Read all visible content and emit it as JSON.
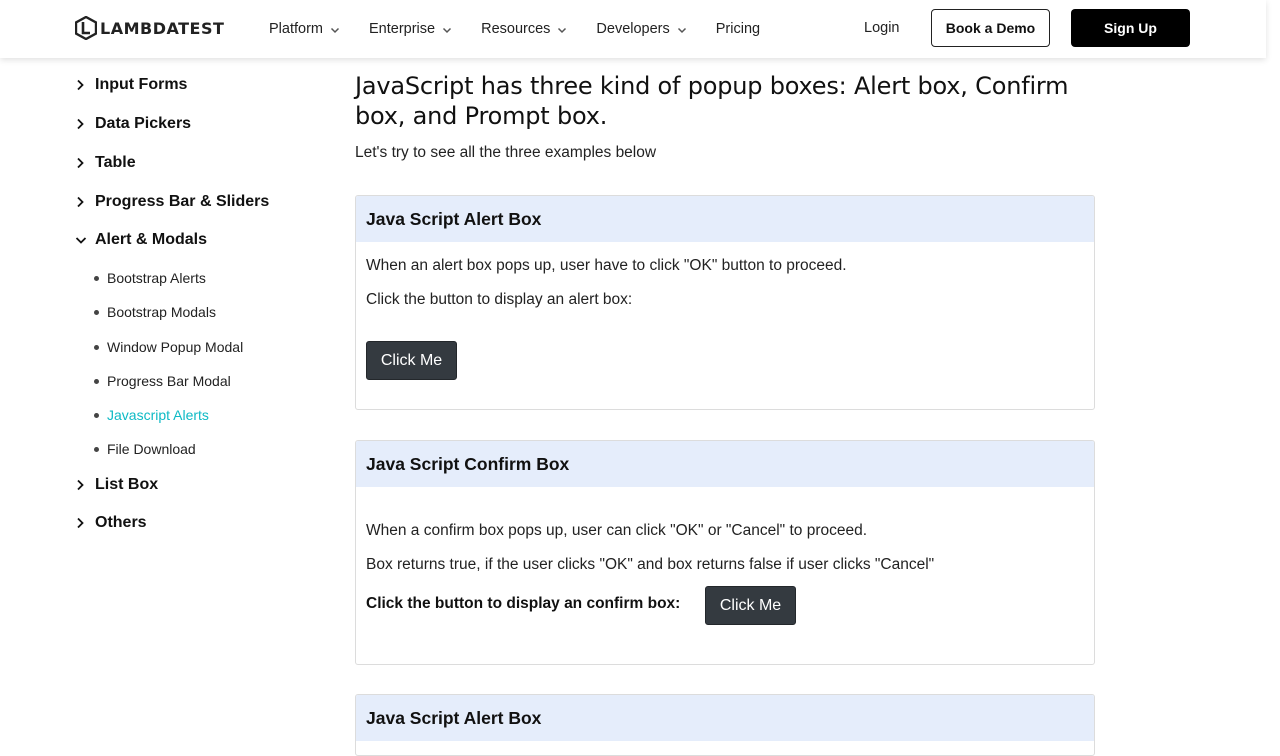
{
  "header": {
    "logo_text": "LAMBDATEST",
    "nav": [
      {
        "label": "Platform"
      },
      {
        "label": "Enterprise"
      },
      {
        "label": "Resources"
      },
      {
        "label": "Developers"
      },
      {
        "label": "Pricing"
      }
    ],
    "login": "Login",
    "book_demo": "Book a Demo",
    "sign_up": "Sign Up"
  },
  "sidebar": {
    "categories_top": [
      {
        "label": "Input Forms"
      },
      {
        "label": "Data Pickers"
      },
      {
        "label": "Table"
      },
      {
        "label": "Progress Bar & Sliders"
      }
    ],
    "expanded": {
      "label": "Alert & Modals",
      "items": [
        {
          "label": "Bootstrap Alerts"
        },
        {
          "label": "Bootstrap Modals"
        },
        {
          "label": "Window Popup Modal"
        },
        {
          "label": "Progress Bar Modal"
        },
        {
          "label": "Javascript Alerts"
        },
        {
          "label": "File Download"
        }
      ]
    },
    "categories_bottom": [
      {
        "label": "List Box"
      },
      {
        "label": "Others"
      }
    ]
  },
  "main": {
    "title": "JavaScript has three kind of popup boxes: Alert box, Confirm box, and Prompt box.",
    "intro": "Let's try to see all the three examples below",
    "alert_card": {
      "title": "Java Script Alert Box",
      "line1": "When an alert box pops up, user have to click \"OK\" button to proceed.",
      "line2": "Click the button to display an alert box:",
      "button": "Click Me"
    },
    "confirm_card": {
      "title": "Java Script Confirm Box",
      "line1": "When a confirm box pops up, user can click \"OK\" or \"Cancel\" to proceed.",
      "line2": "Box returns true, if the user clicks \"OK\" and box returns false if user clicks \"Cancel\"",
      "line3": "Click the button to display an confirm box:",
      "button": "Click Me"
    },
    "third_card": {
      "title": "Java Script Alert Box"
    }
  },
  "colors": {
    "accent": "#0ebac5",
    "card_header_bg": "#e5edfb",
    "button_dark": "#343a40"
  },
  "icons": {
    "logo": "lambdatest-logo-icon",
    "nav_chevron": "chevron-down-icon",
    "collapsed": "chevron-right-icon",
    "expanded": "chevron-down-icon"
  }
}
